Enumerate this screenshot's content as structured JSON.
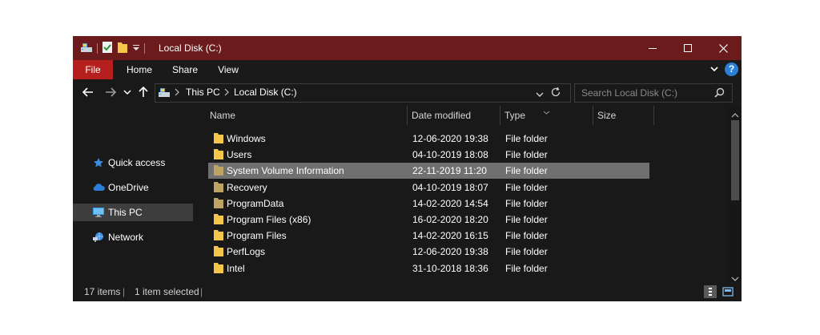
{
  "window": {
    "title": "Local Disk (C:)"
  },
  "ribbon": {
    "tabs": [
      "File",
      "Home",
      "Share",
      "View"
    ]
  },
  "address": {
    "crumbs": [
      "This PC",
      "Local Disk (C:)"
    ]
  },
  "search": {
    "placeholder": "Search Local Disk (C:)"
  },
  "nav_pane": {
    "items": [
      "Quick access",
      "OneDrive",
      "This PC",
      "Network"
    ],
    "selected": "This PC"
  },
  "file_list": {
    "columns": [
      "Name",
      "Date modified",
      "Type",
      "Size"
    ],
    "rows": [
      {
        "name": "Windows",
        "date": "12-06-2020 19:38",
        "type": "File folder"
      },
      {
        "name": "Users",
        "date": "04-10-2019 18:08",
        "type": "File folder"
      },
      {
        "name": "System Volume Information",
        "date": "22-11-2019 11:20",
        "type": "File folder"
      },
      {
        "name": "Recovery",
        "date": "04-10-2019 18:07",
        "type": "File folder"
      },
      {
        "name": "ProgramData",
        "date": "14-02-2020 14:54",
        "type": "File folder"
      },
      {
        "name": "Program Files (x86)",
        "date": "16-02-2020 18:20",
        "type": "File folder"
      },
      {
        "name": "Program Files",
        "date": "14-02-2020 16:15",
        "type": "File folder"
      },
      {
        "name": "PerfLogs",
        "date": "12-06-2020 19:38",
        "type": "File folder"
      },
      {
        "name": "Intel",
        "date": "31-10-2018 18:36",
        "type": "File folder"
      }
    ],
    "selected_row": "System Volume Information"
  },
  "status": {
    "items_count": "17 items",
    "selected_count": "1 item selected"
  },
  "colors": {
    "titlebar": "#6b1b1c",
    "file_tab": "#b5201f",
    "background": "#191919",
    "selection": "#707070",
    "folder": "#f4c74a",
    "folder_dim": "#bda462",
    "accent_blue": "#2b7fd6"
  }
}
